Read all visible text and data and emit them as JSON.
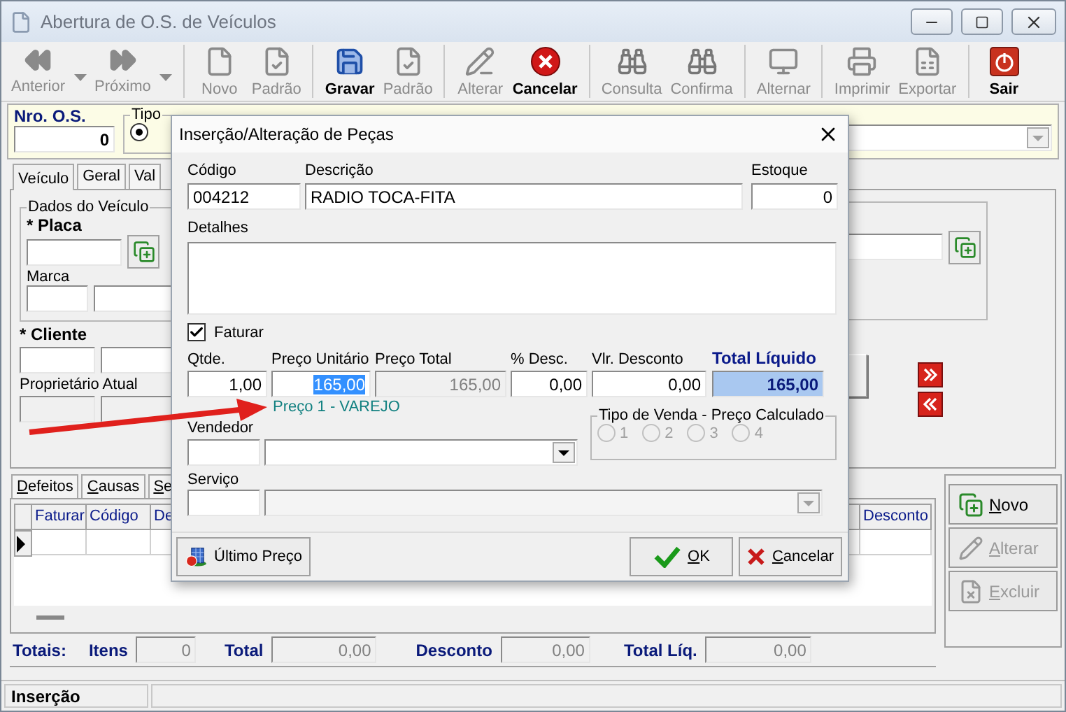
{
  "window": {
    "title": "Abertura de O.S. de Veículos"
  },
  "toolbar": [
    {
      "label": "Anterior",
      "kind": "rewind",
      "disabled": true,
      "dropdown": true,
      "group_start": false
    },
    {
      "label": "Próximo",
      "kind": "forward",
      "disabled": true,
      "dropdown": true,
      "group_start": false
    },
    {
      "label": "Novo",
      "kind": "document",
      "disabled": true,
      "dropdown": false,
      "group_start": true
    },
    {
      "label": "Padrão",
      "kind": "document-check",
      "disabled": true,
      "dropdown": false,
      "group_start": false
    },
    {
      "label": "Gravar",
      "kind": "floppy",
      "disabled": false,
      "dropdown": false,
      "group_start": true
    },
    {
      "label": "Padrão",
      "kind": "document-check",
      "disabled": true,
      "dropdown": false,
      "group_start": false
    },
    {
      "label": "Alterar",
      "kind": "pencil",
      "disabled": true,
      "dropdown": false,
      "group_start": true
    },
    {
      "label": "Cancelar",
      "kind": "cancel",
      "disabled": false,
      "dropdown": false,
      "group_start": false
    },
    {
      "label": "Consulta",
      "kind": "binoculars",
      "disabled": true,
      "dropdown": false,
      "group_start": true
    },
    {
      "label": "Confirma",
      "kind": "binoculars",
      "disabled": true,
      "dropdown": false,
      "group_start": false
    },
    {
      "label": "Alternar",
      "kind": "monitor",
      "disabled": true,
      "dropdown": false,
      "group_start": true
    },
    {
      "label": "Imprimir",
      "kind": "printer",
      "disabled": true,
      "dropdown": false,
      "group_start": true
    },
    {
      "label": "Exportar",
      "kind": "spreadsheet",
      "disabled": true,
      "dropdown": false,
      "group_start": false
    },
    {
      "label": "Sair",
      "kind": "power",
      "disabled": false,
      "dropdown": false,
      "group_start": true
    }
  ],
  "header": {
    "os_label": "Nro. O.S.",
    "os_value": "0",
    "type_label": "Tipo",
    "type_radio_selected": true
  },
  "tabs": [
    {
      "label": "Veículo",
      "selected": true
    },
    {
      "label": "Geral",
      "selected": false
    },
    {
      "label": "Val",
      "selected": false
    }
  ],
  "vehicle": {
    "group_title": "Dados do Veículo",
    "plate_label": "* Placa",
    "brand_label": "Marca",
    "client_label": "* Cliente",
    "owner_label": "Proprietário Atual"
  },
  "detail_tabs": [
    "Defeitos",
    "Causas",
    "Se"
  ],
  "grid": {
    "columns": [
      "Faturar",
      "Código",
      "De",
      "Desconto"
    ]
  },
  "totals": {
    "label": "Totais:",
    "items_label": "Itens",
    "items": "0",
    "total_label": "Total",
    "total": "0,00",
    "discount_label": "Desconto",
    "discount": "0,00",
    "net_label": "Total Líq.",
    "net": "0,00"
  },
  "side_buttons": [
    {
      "label": "Novo",
      "kind": "new",
      "disabled": false
    },
    {
      "label": "Alterar",
      "kind": "edit",
      "disabled": true
    },
    {
      "label": "Excluir",
      "kind": "delete",
      "disabled": true
    }
  ],
  "status_bar": [
    "Inserção"
  ],
  "dialog": {
    "title": "Inserção/Alteração de Peças",
    "code_label": "Código",
    "code": "004212",
    "description_label": "Descrição",
    "description": "RADIO TOCA-FITA",
    "stock_label": "Estoque",
    "stock": "0",
    "details_label": "Detalhes",
    "invoice": {
      "label": "Faturar",
      "checked": true
    },
    "prices": [
      {
        "label": "Qtde.",
        "value": "1,00",
        "kind": "input"
      },
      {
        "label": "Preço Unitário",
        "value": "165,00",
        "kind": "selected"
      },
      {
        "label": "Preço Total",
        "value": "165,00",
        "kind": "readonly"
      },
      {
        "label": "% Desc.",
        "value": "0,00",
        "kind": "input"
      },
      {
        "label": "Vlr. Desconto",
        "value": "0,00",
        "kind": "input"
      },
      {
        "label": "Total Líquido",
        "value": "165,00",
        "kind": "total"
      }
    ],
    "price_tier": "Preço 1 - VAREJO",
    "seller_label": "Vendedor",
    "sale_type": {
      "title": "Tipo de Venda - Preço Calculado",
      "disabled": true,
      "options": [
        {
          "label": "1",
          "selected": false
        },
        {
          "label": "2",
          "selected": false
        },
        {
          "label": "3",
          "selected": false
        },
        {
          "label": "4",
          "selected": false
        }
      ]
    },
    "service_label": "Serviço",
    "service_disabled": true,
    "buttons": [
      {
        "label": "Último Preço",
        "kind": "last-price"
      },
      {
        "label": "OK",
        "kind": "ok"
      },
      {
        "label": "Cancelar",
        "kind": "cancel"
      }
    ]
  }
}
